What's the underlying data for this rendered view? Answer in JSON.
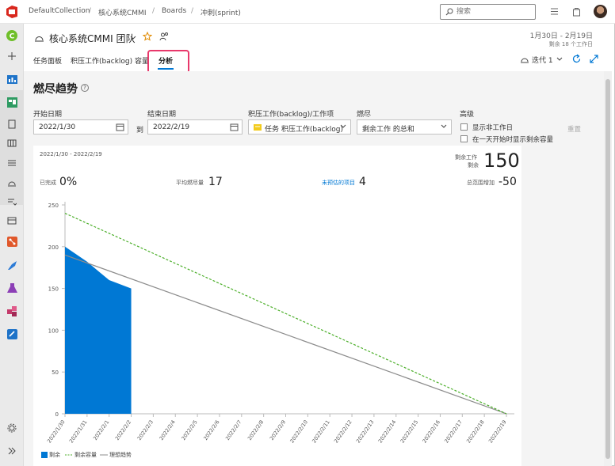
{
  "topbar": {
    "breadcrumbs": [
      "DefaultCollection",
      "核心系统CMMI",
      "Boards",
      "冲刺(sprint)"
    ],
    "search_placeholder": "搜索"
  },
  "header": {
    "team_name": "核心系统CMMI 团队",
    "date_range": "1月30日 - 2月19日",
    "remaining_days": "剩余 18 个工作日",
    "iteration": "迭代 1"
  },
  "tabs": [
    "任务面板",
    "积压工作(backlog)",
    "容量",
    "分析"
  ],
  "active_tab": "分析",
  "section": {
    "title": "燃尽趋势",
    "help": "?"
  },
  "filters": {
    "start_label": "开始日期",
    "start_value": "2022/1/30",
    "to_label": "到",
    "end_label": "结束日期",
    "end_value": "2022/2/19",
    "backlog_label": "积压工作(backlog)/工作项",
    "backlog_value": "任务 积压工作(backlog)",
    "burndown_label": "燃尽",
    "burndown_value": "剩余工作 的总和",
    "advanced_label": "高级",
    "show_non_working": "显示非工作日",
    "show_remaining_capacity": "在一天开始时显示剩余容量",
    "reset": "重置"
  },
  "summary": {
    "range": "2022/1/30 - 2022/2/19",
    "remaining_work_label": "剩余工作",
    "remaining_label": "剩余",
    "remaining_value": "150",
    "completed_label": "已完成",
    "completed_value": "0%",
    "avg_burn_label": "平均燃尽量",
    "avg_burn_value": "17",
    "unestimated_label": "未预估的项目",
    "unestimated_value": "4",
    "scope_label": "总范围增加",
    "scope_value": "-50"
  },
  "colors": {
    "remaining": "#0078d4",
    "capacity": "#4caf2a",
    "ideal": "#8c8c8c",
    "highlight": "#e8386b"
  },
  "chart_data": {
    "type": "area",
    "x": [
      "2022/1/30",
      "2022/1/31",
      "2022/2/1",
      "2022/2/2",
      "2022/2/3",
      "2022/2/4",
      "2022/2/5",
      "2022/2/6",
      "2022/2/7",
      "2022/2/8",
      "2022/2/9",
      "2022/2/10",
      "2022/2/11",
      "2022/2/12",
      "2022/2/13",
      "2022/2/14",
      "2022/2/15",
      "2022/2/16",
      "2022/2/17",
      "2022/2/18",
      "2022/2/19"
    ],
    "ylim": [
      0,
      250
    ],
    "yticks": [
      0,
      50,
      100,
      150,
      200,
      250
    ],
    "series": [
      {
        "name": "剩余",
        "type": "area",
        "values": [
          200,
          182,
          160,
          150
        ]
      },
      {
        "name": "剩余容量",
        "type": "line-dashed",
        "values": [
          240,
          0
        ],
        "x_index": [
          0,
          20
        ]
      },
      {
        "name": "理想趋势",
        "type": "line",
        "values": [
          190,
          0
        ],
        "x_index": [
          0,
          20
        ]
      }
    ],
    "legend_position": "bottom-left"
  }
}
